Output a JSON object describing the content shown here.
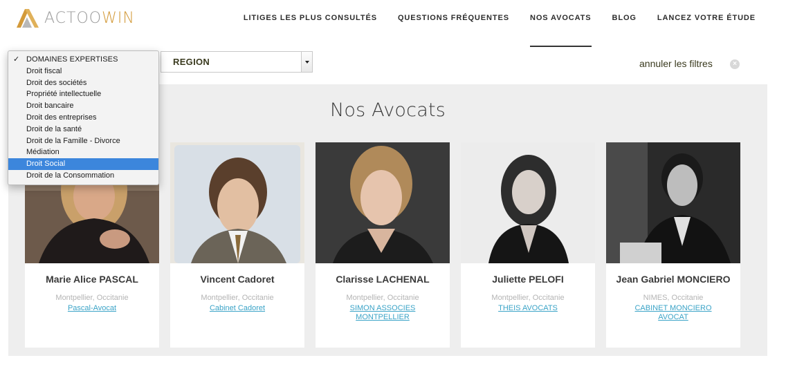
{
  "brand": {
    "name_part1": "ACTOO",
    "name_part2": "WIN"
  },
  "nav": [
    {
      "label": "LITIGES LES PLUS CONSULTÉS"
    },
    {
      "label": "QUESTIONS FRÉQUENTES"
    },
    {
      "label": "NOS AVOCATS",
      "active": true
    },
    {
      "label": "BLOG"
    },
    {
      "label": "LANCEZ VOTRE ÉTUDE"
    }
  ],
  "filters": {
    "region_value": "REGION",
    "reset_label": "annuler les filtres",
    "reset_icon": "×"
  },
  "dropdown": {
    "check_glyph": "✓",
    "selected_index": 9,
    "items": [
      "DOMAINES EXPERTISES",
      "Droit fiscal",
      "Droit des sociétés",
      "Propriété intellectuelle",
      "Droit bancaire",
      "Droit des entreprises",
      "Droit de la santé",
      "Droit de la Famille - Divorce",
      "Médiation",
      "Droit Social",
      "Droit de la Consommation"
    ]
  },
  "section": {
    "title": "Nos Avocats"
  },
  "lawyers": [
    {
      "name": "Marie Alice PASCAL",
      "location": "Montpellier, Occitanie",
      "firm": "Pascal-Avocat"
    },
    {
      "name": "Vincent Cadoret",
      "location": "Montpellier, Occitanie",
      "firm": "Cabinet Cadoret"
    },
    {
      "name": "Clarisse LACHENAL",
      "location": "Montpellier, Occitanie",
      "firm": "SIMON ASSOCIES MONTPELLIER"
    },
    {
      "name": "Juliette PELOFI",
      "location": "Montpellier, Occitanie",
      "firm": "THEIS AVOCATS"
    },
    {
      "name": "Jean Gabriel MONCIERO",
      "location": "NIMES, Occitanie",
      "firm": "CABINET MONCIERO AVOCAT"
    }
  ],
  "colors": {
    "brand_gold": "#d39a3a",
    "link": "#3aa3c7",
    "selected": "#3c86dc",
    "section_bg": "#eeeeee"
  }
}
